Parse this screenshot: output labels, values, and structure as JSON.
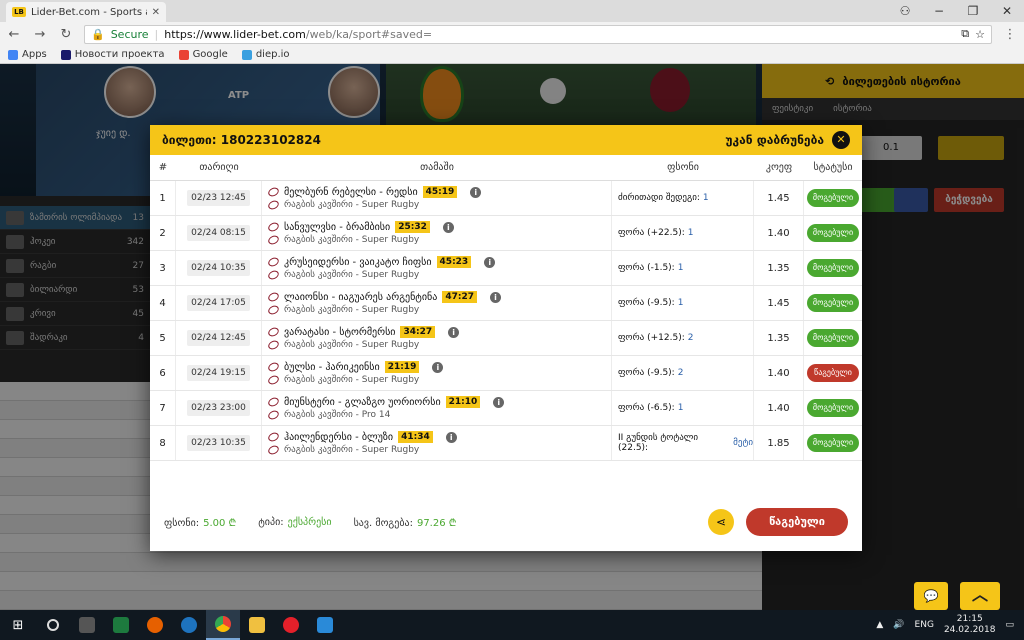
{
  "browser": {
    "tab_title": "Lider-Bet.com - Sports a",
    "url_secure": "Secure",
    "url_domain": "https://www.lider-bet.com",
    "url_path": "/web/ka/sport#saved=",
    "bookmarks": [
      "Apps",
      "Новости проекта",
      "Google",
      "diep.io"
    ]
  },
  "background": {
    "banner_player_name": "ჯუიე დ.",
    "banner_league": "ATP",
    "sidebar_items": [
      {
        "label": "ზამთრის ოლიმპიადა",
        "count": "13"
      },
      {
        "label": "ჰოკეი",
        "count": "342"
      },
      {
        "label": "რაგბი",
        "count": "27"
      },
      {
        "label": "ბილიარდი",
        "count": "53"
      },
      {
        "label": "კრივი",
        "count": "45"
      },
      {
        "label": "შადრაკი",
        "count": "4"
      }
    ],
    "right_header": "ბილეთების ისტორია",
    "right_tabs": [
      "ფეისტიკი",
      "ისტორია"
    ],
    "right_value": "0.1",
    "right_btn": "ბეჭდვება"
  },
  "modal": {
    "ticket_label": "ბილეთი: 180223102824",
    "back_label": "უკან დაბრუნება",
    "columns": [
      "#",
      "თარიღი",
      "თამაში",
      "ფსონი",
      "კოეფ",
      "სტატუსი"
    ],
    "rows": [
      {
        "n": "1",
        "date": "02/23 12:45",
        "match": "მელბურნ რებელსი - რედსი",
        "score": "45:19",
        "league": "რაგბის კავშირი - Super Rugby",
        "bet": "ძირითადი შედეგი:",
        "bet_val": "1",
        "odd": "1.45",
        "status": "მოგებული",
        "win": true
      },
      {
        "n": "2",
        "date": "02/24 08:15",
        "match": "სანვულვსი - ბრამბისი",
        "score": "25:32",
        "league": "რაგბის კავშირი - Super Rugby",
        "bet": "ფორა (+22.5):",
        "bet_val": "1",
        "odd": "1.40",
        "status": "მოგებული",
        "win": true
      },
      {
        "n": "3",
        "date": "02/24 10:35",
        "match": "კრუსეიდერსი - ვაიკატო ჩიფსი",
        "score": "45:23",
        "league": "რაგბის კავშირი - Super Rugby",
        "bet": "ფორა (-1.5):",
        "bet_val": "1",
        "odd": "1.35",
        "status": "მოგებული",
        "win": true
      },
      {
        "n": "4",
        "date": "02/24 17:05",
        "match": "ლაიონსი - იაგუარეს არგენტინა",
        "score": "47:27",
        "league": "რაგბის კავშირი - Super Rugby",
        "bet": "ფორა (-9.5):",
        "bet_val": "1",
        "odd": "1.45",
        "status": "მოგებული",
        "win": true
      },
      {
        "n": "5",
        "date": "02/24 12:45",
        "match": "ვარატასი - სტორმერსი",
        "score": "34:27",
        "league": "რაგბის კავშირი - Super Rugby",
        "bet": "ფორა (+12.5):",
        "bet_val": "2",
        "odd": "1.35",
        "status": "მოგებული",
        "win": true
      },
      {
        "n": "6",
        "date": "02/24 19:15",
        "match": "ბულსი - ჰარიკეინსი",
        "score": "21:19",
        "league": "რაგბის კავშირი - Super Rugby",
        "bet": "ფორა (-9.5):",
        "bet_val": "2",
        "odd": "1.40",
        "status": "წაგებული",
        "win": false
      },
      {
        "n": "7",
        "date": "02/23 23:00",
        "match": "მიუნსტერი - გლაზგო უორიორსი",
        "score": "21:10",
        "league": "რაგბის კავშირი - Pro 14",
        "bet": "ფორა (-6.5):",
        "bet_val": "1",
        "odd": "1.40",
        "status": "მოგებული",
        "win": true
      },
      {
        "n": "8",
        "date": "02/23 10:35",
        "match": "ჰაილენდერსი - ბლუზი",
        "score": "41:34",
        "league": "რაგბის კავშირი - Super Rugby",
        "bet": "II გუნდის ტოტალი (22.5):",
        "bet_val": "მეტი",
        "odd": "1.85",
        "status": "მოგებული",
        "win": true
      }
    ],
    "footer": {
      "stake_label": "ფსონი:",
      "stake_value": "5.00 ₾",
      "type_label": "ტიპი:",
      "type_value": "ექსპრესი",
      "win_label": "სავ. მოგება:",
      "win_value": "97.26 ₾",
      "lost_btn": "წაგებული"
    }
  },
  "taskbar": {
    "lang": "ENG",
    "time": "21:15",
    "date": "24.02.2018"
  }
}
